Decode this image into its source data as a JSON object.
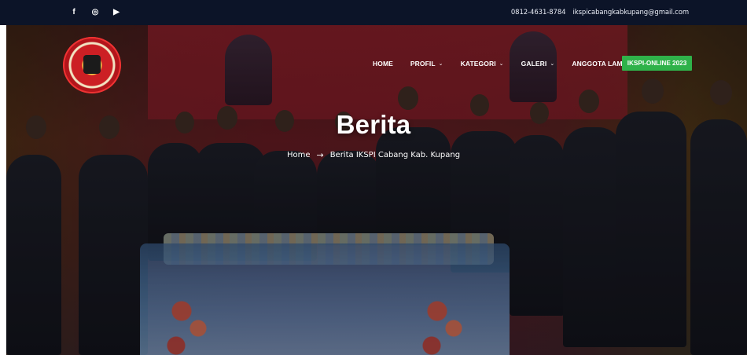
{
  "topbar": {
    "social": [
      {
        "icon": "facebook-icon",
        "glyph": "f"
      },
      {
        "icon": "instagram-icon",
        "glyph": "◎"
      },
      {
        "icon": "youtube-icon",
        "glyph": "▶"
      }
    ],
    "phone": "0812-4631-8784",
    "email": "ikspicabangkabkupang@gmail.com"
  },
  "nav": {
    "items": [
      {
        "label": "HOME",
        "has_dropdown": false
      },
      {
        "label": "PROFIL",
        "has_dropdown": true
      },
      {
        "label": "KATEGORI",
        "has_dropdown": true
      },
      {
        "label": "GALERI",
        "has_dropdown": true
      },
      {
        "label": "ANGGOTA LAMA",
        "has_dropdown": false
      }
    ],
    "chevron": "⌄",
    "cta_label": "IKSPI-ONLINE 2023"
  },
  "hero": {
    "title": "Berita",
    "breadcrumb": {
      "home": "Home",
      "separator": "→",
      "current": "Berita IKSPI Cabang Kab. Kupang"
    }
  },
  "colors": {
    "topbar_bg": "#0c1428",
    "cta_bg": "#2fb24a",
    "text": "#ffffff"
  }
}
